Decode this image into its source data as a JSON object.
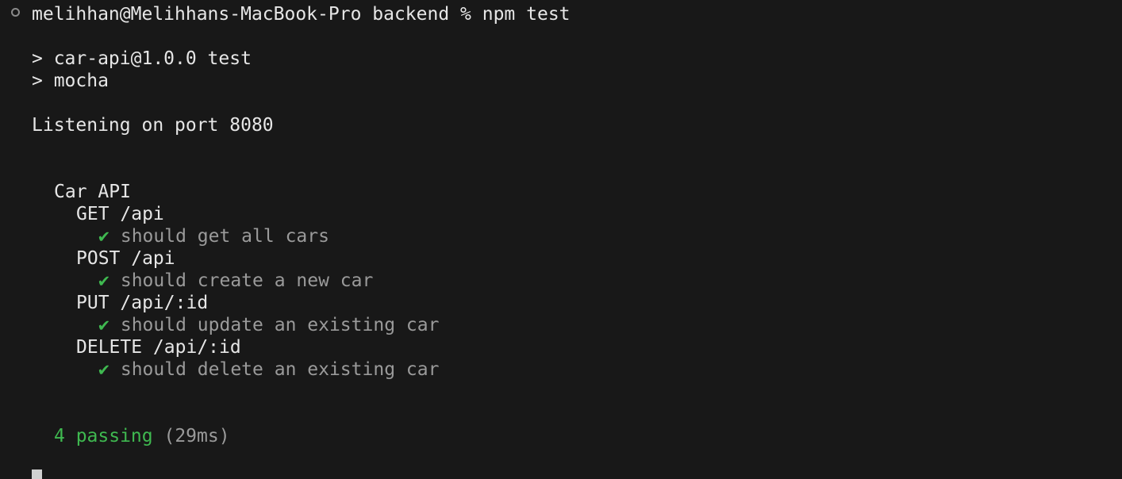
{
  "prompt": {
    "text": "melihhan@Melihhans-MacBook-Pro backend % npm test",
    "marker_icon": "circle-icon"
  },
  "npm": {
    "script_line": "> car-api@1.0.0 test",
    "command_line": "> mocha"
  },
  "server_log": "Listening on port 8080",
  "suite": {
    "name": "Car API",
    "groups": [
      {
        "title": "GET /api",
        "test": "should get all cars"
      },
      {
        "title": "POST /api",
        "test": "should create a new car"
      },
      {
        "title": "PUT /api/:id",
        "test": "should update an existing car"
      },
      {
        "title": "DELETE /api/:id",
        "test": "should delete an existing car"
      }
    ],
    "check_glyph": "✔"
  },
  "summary": {
    "passing": "4 passing",
    "duration": "(29ms)"
  },
  "colors": {
    "background": "#181818",
    "text": "#e6e6e6",
    "pass": "#3fb950",
    "dim": "#9a9a9a"
  }
}
